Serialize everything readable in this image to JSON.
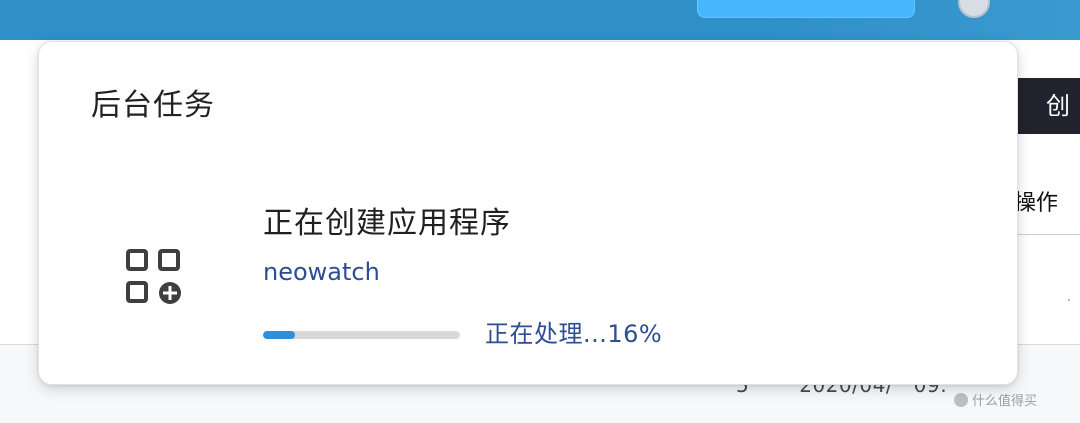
{
  "background": {
    "dark_header_text": "创",
    "column_header_text": "操作",
    "row_value_1": "5",
    "row_value_2": "2020/04/",
    "row_value_3": "09:",
    "watermark": "什么值得买"
  },
  "popup": {
    "title": "后台任务"
  },
  "task": {
    "icon_name": "apps-add-icon",
    "title": "正在创建应用程序",
    "subtitle": "neowatch",
    "progress_percent": 16,
    "status_text": "正在处理...16%"
  },
  "colors": {
    "topbar": "#2f8fc7",
    "progress_fill": "#2f8fdb",
    "link_text": "#2e4e93"
  }
}
